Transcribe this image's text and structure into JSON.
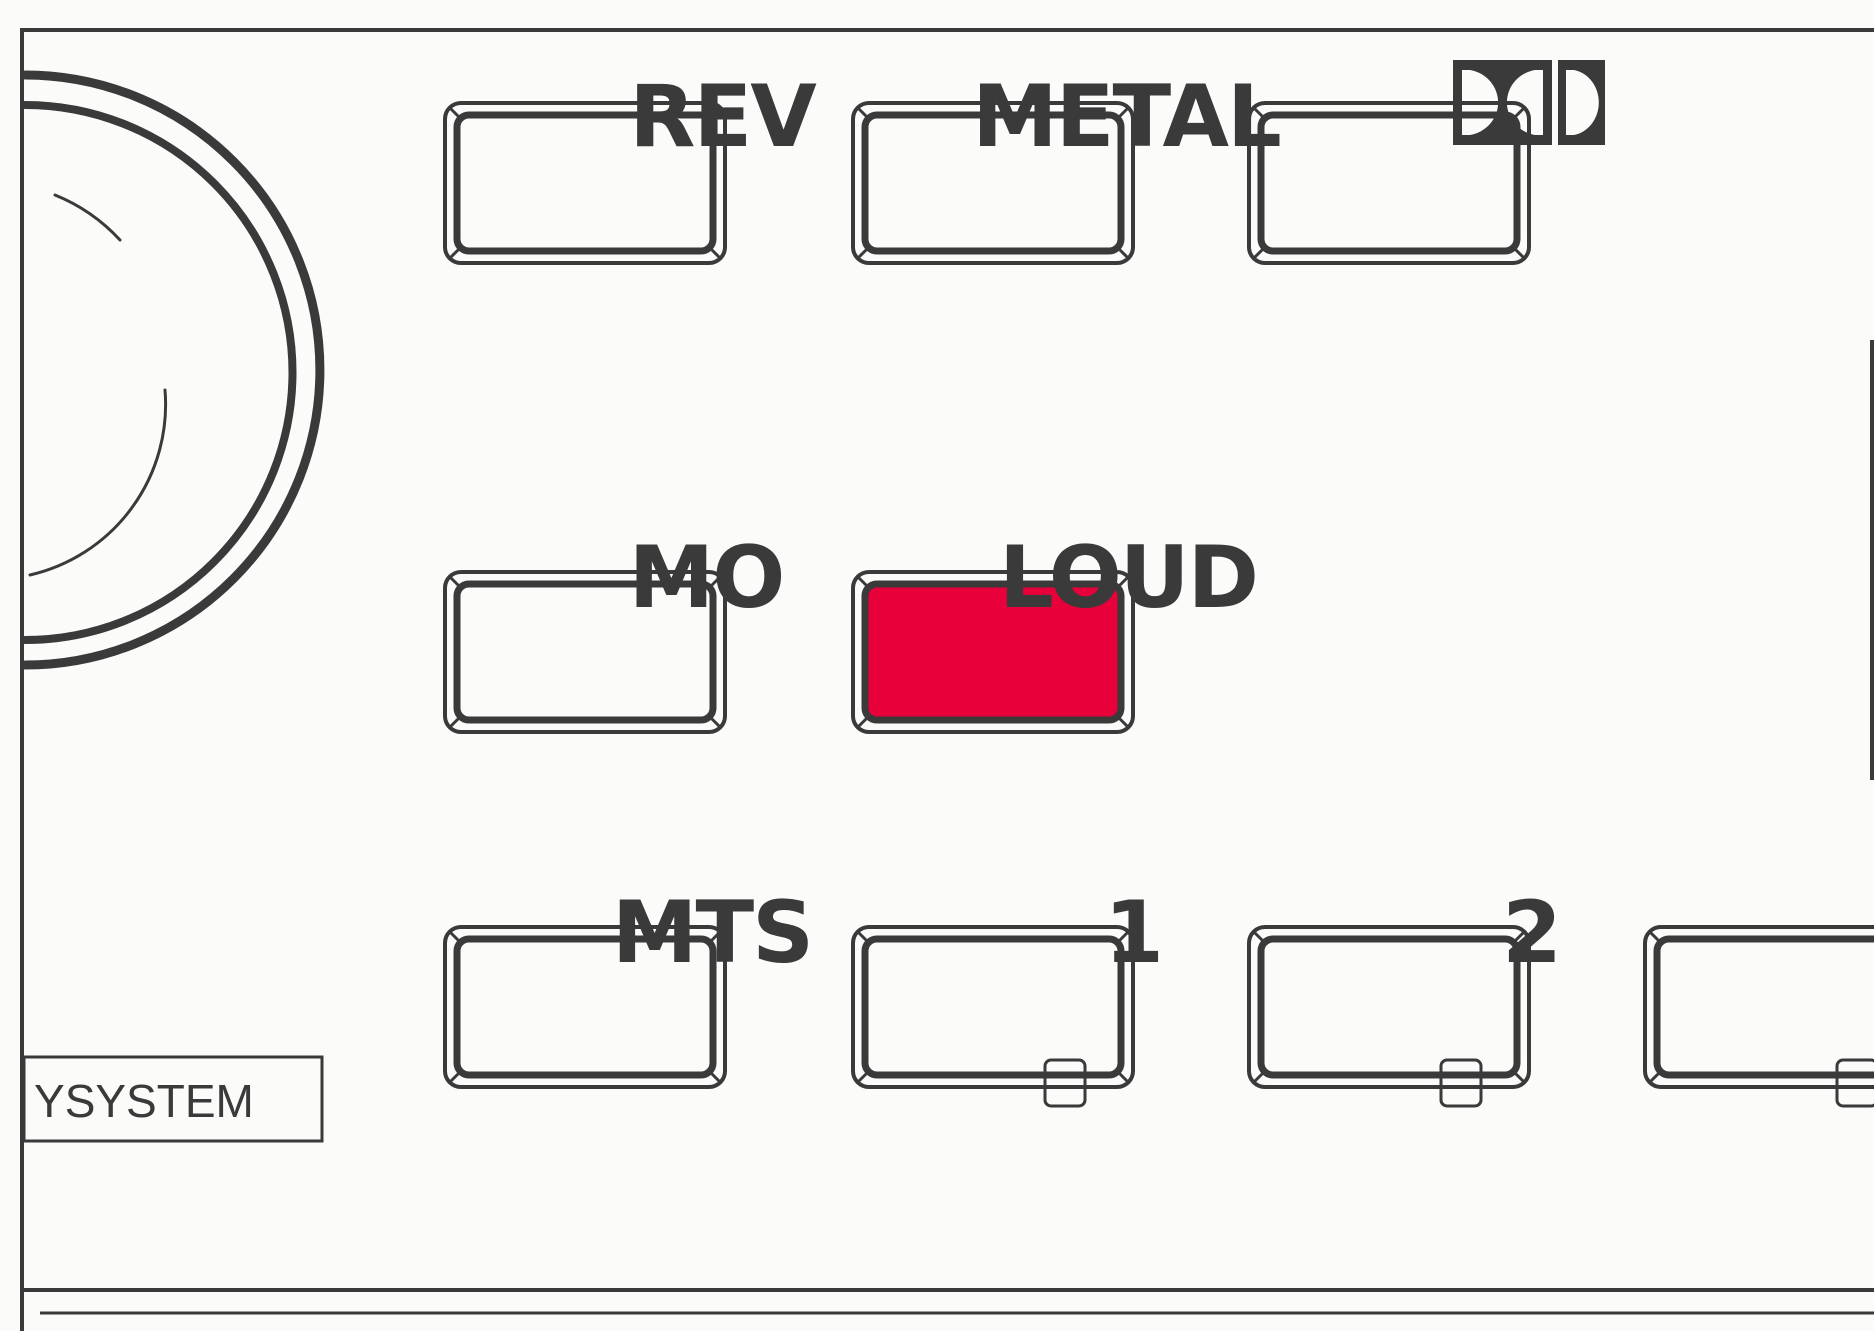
{
  "labels": {
    "rev": "REV",
    "metal": "METAL",
    "mo": "MO",
    "loud": "LOUD",
    "mts": "MTS",
    "one": "1",
    "two": "2"
  },
  "system_label": "SYSTEM",
  "system_label_prefix": "Y",
  "buttons": [
    {
      "key": "rev",
      "state": "off"
    },
    {
      "key": "metal",
      "state": "off"
    },
    {
      "key": "dolby",
      "state": "off"
    },
    {
      "key": "mo",
      "state": "off"
    },
    {
      "key": "loud",
      "state": "on"
    },
    {
      "key": "mts",
      "state": "off"
    },
    {
      "key": "preset-1",
      "state": "off"
    },
    {
      "key": "preset-2",
      "state": "off"
    },
    {
      "key": "preset-3",
      "state": "off"
    }
  ],
  "icons": {
    "dolby": "dolby-double-d-icon",
    "knob": "volume-knob-icon",
    "indicator": "led-indicator-icon"
  },
  "colors": {
    "line": "#3a3a3a",
    "panel": "#fbfbfa",
    "loud_active": "#e8003a"
  }
}
